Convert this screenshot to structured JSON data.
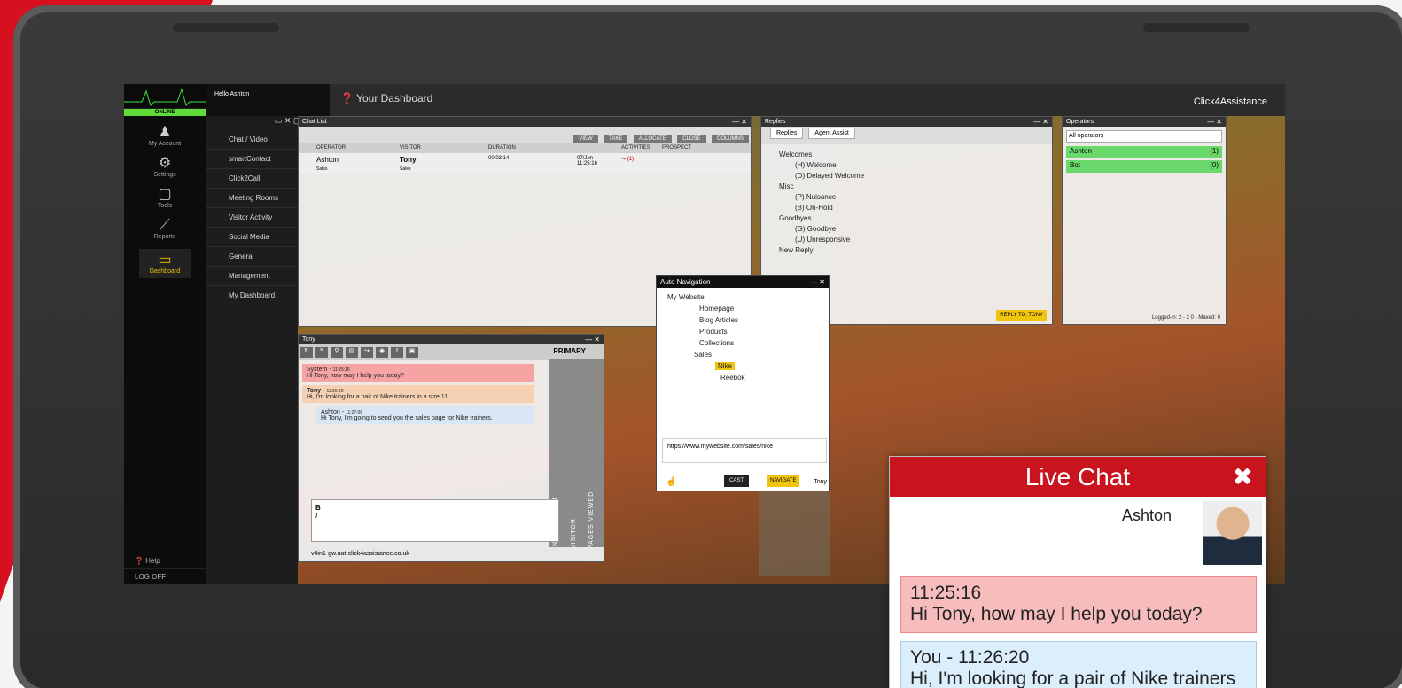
{
  "nav": {
    "status": "ONLINE",
    "items": [
      {
        "label": "My Account",
        "icon": "user-icon"
      },
      {
        "label": "Settings",
        "icon": "gear-icon"
      },
      {
        "label": "Tools",
        "icon": "code-icon"
      },
      {
        "label": "Reports",
        "icon": "chart-icon"
      },
      {
        "label": "Dashboard",
        "icon": "monitor-icon"
      }
    ],
    "help": "Help",
    "logoff": "LOG OFF"
  },
  "subnav": {
    "hello": "Hello Ashton",
    "items": [
      "Chat / Video",
      "smartContact",
      "Click2Call",
      "Meeting Rooms",
      "Visitor Activity",
      "Social Media",
      "General",
      "Management",
      "My Dashboard"
    ]
  },
  "header": {
    "title": "Your Dashboard",
    "brand": "Click4Assistance"
  },
  "chatlist": {
    "title": "Chat List",
    "buttons": [
      "VIEW",
      "TAKE",
      "ALLOCATE",
      "CLOSE",
      "COLUMNS"
    ],
    "columns": [
      "OPERATOR",
      "VISITOR",
      "DURATION",
      "",
      "ACTIVITIES",
      "PROSPECT"
    ],
    "row": {
      "operator": "Ashton",
      "operator_dept": "Sales",
      "visitor": "Tony",
      "visitor_dept": "Sales",
      "duration": "00:03:14",
      "date": "07/Jun",
      "time": "11:25:16",
      "activities": "(1)"
    }
  },
  "replies": {
    "title": "Replies",
    "tabs": [
      "Replies",
      "Agent Assist"
    ],
    "tree": [
      "Welcomes",
      "(H) Welcome",
      "(D) Delayed Welcome",
      "Misc",
      "(P) Nuisance",
      "(B) On-Hold",
      "Goodbyes",
      "(G) Goodbye",
      "(U) Unresponsive",
      "New Reply"
    ],
    "reply_button": "REPLY TO: TONY"
  },
  "operators": {
    "title": "Operators",
    "select": "All operators",
    "list": [
      {
        "name": "Ashton",
        "count": "(1)"
      },
      {
        "name": "Bot",
        "count": "(0)"
      }
    ],
    "footer": "Logged-in: 2 - 2 0 - Maxed: 0"
  },
  "tony": {
    "title": "Tony",
    "tab": "PRIMARY",
    "messages": [
      {
        "from": "System",
        "time": "11:25:16",
        "text": "Hi Tony, how may I help you today?"
      },
      {
        "from": "Tony",
        "time": "11:26:20",
        "text": "Hi, I'm looking for a pair of Nike trainers in a size 11."
      },
      {
        "from": "Ashton",
        "time": "11:27:08",
        "text": "Hi Tony, I'm going to send you the sales page for Nike trainers."
      }
    ],
    "side_tabs": [
      "INFORMATION",
      "VISITOR",
      "PAGES VIEWED"
    ],
    "url": "v4in1-gw.uat-click4assistance.co.uk"
  },
  "autonav": {
    "title": "Auto Navigation",
    "tree": [
      "My Website",
      "Homepage",
      "Blog Articles",
      "Products",
      "Collections",
      "Sales",
      "Nike",
      "Reebok"
    ],
    "url": "https://www.mywebsite.com/sales/nike",
    "cast": "CAST",
    "navigate": "NAVIGATE",
    "user": "Tony"
  },
  "livechat": {
    "title": "Live Chat",
    "agent": "Ashton",
    "m1_time": "11:25:16",
    "m1_text": "Hi Tony, how may I help you today?",
    "m2_time": "You - 11:26:20",
    "m2_text": "Hi, I'm looking for a pair of Nike trainers"
  }
}
